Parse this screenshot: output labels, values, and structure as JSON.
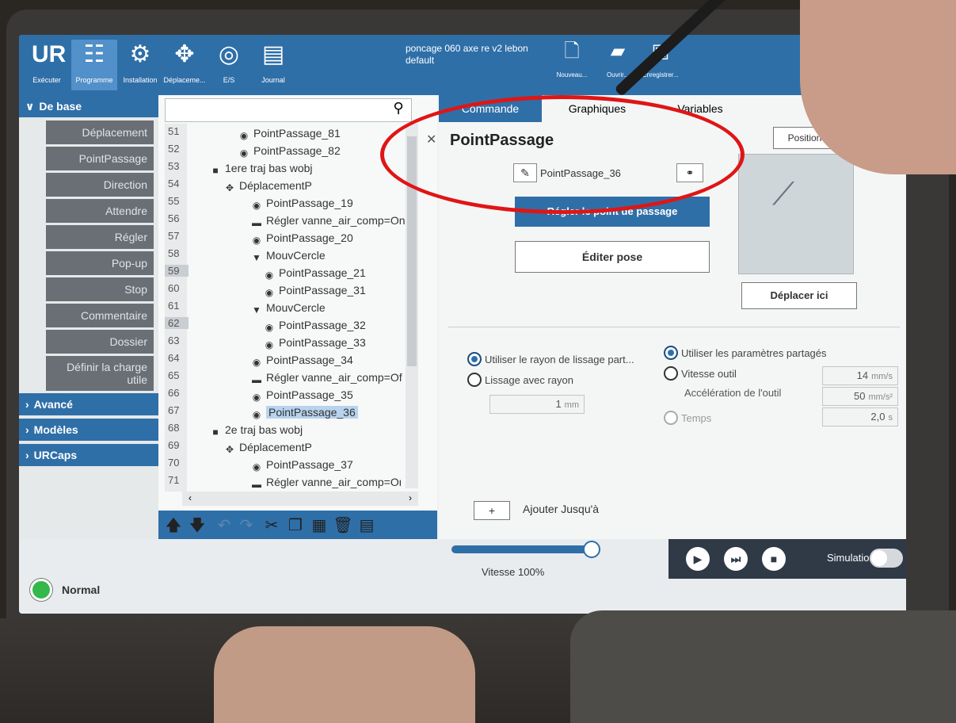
{
  "toolbar": {
    "tools": [
      {
        "label": "Exécuter",
        "icon": "ur-logo-icon"
      },
      {
        "label": "Programme",
        "icon": "program-icon"
      },
      {
        "label": "Installation",
        "icon": "installation-icon"
      },
      {
        "label": "Déplaceme...",
        "icon": "move-icon"
      },
      {
        "label": "E/S",
        "icon": "io-icon"
      },
      {
        "label": "Journal",
        "icon": "log-icon"
      }
    ],
    "program_name": "poncage 060 axe re v2 lebon",
    "installation_name": "default",
    "file_tools": [
      {
        "label": "Nouveau...",
        "icon": "new-file-icon"
      },
      {
        "label": "Ouvrir...",
        "icon": "open-folder-icon"
      },
      {
        "label": "Enregistrer...",
        "icon": "save-icon"
      }
    ]
  },
  "categories": {
    "basic_header": "De base",
    "basic_items": [
      "Déplacement",
      "PointPassage",
      "Direction",
      "Attendre",
      "Régler",
      "Pop-up",
      "Stop",
      "Commentaire",
      "Dossier",
      "Définir la charge utile"
    ],
    "advanced": "Avancé",
    "templates": "Modèles",
    "urcaps": "URCaps"
  },
  "tree": {
    "line_numbers": [
      "51",
      "52",
      "53",
      "54",
      "55",
      "56",
      "57",
      "58",
      "59",
      "60",
      "61",
      "62",
      "63",
      "64",
      "65",
      "66",
      "67",
      "68",
      "69",
      "70",
      "71"
    ],
    "nodes": [
      "PointPassage_81",
      "PointPassage_82",
      "1ere traj bas wobj",
      "DéplacementP",
      "PointPassage_19",
      "Régler vanne_air_comp=On",
      "PointPassage_20",
      "MouvCercle",
      "PointPassage_21",
      "PointPassage_31",
      "MouvCercle",
      "PointPassage_32",
      "PointPassage_33",
      "PointPassage_34",
      "Régler vanne_air_comp=Of",
      "PointPassage_35",
      "PointPassage_36",
      "2e traj bas wobj",
      "DéplacementP",
      "PointPassage_37",
      "Régler vanne_air_comp=On"
    ],
    "selected": "PointPassage_36"
  },
  "panel": {
    "tabs": [
      "Commande",
      "Graphiques",
      "Variables"
    ],
    "title": "PointPassage",
    "waypoint_name": "PointPassage_36",
    "fixed_position": "Position fixe",
    "set_waypoint": "Régler le point de passage",
    "edit_pose": "Éditer pose",
    "move_here": "Déplacer ici",
    "blend_shared": "Utiliser le rayon de lissage part...",
    "blend_radius": "Lissage avec rayon",
    "blend_value": "1",
    "blend_unit": "mm",
    "params_shared": "Utiliser les paramètres partagés",
    "tool_speed": "Vitesse outil",
    "tool_speed_value": "14",
    "tool_speed_unit": "mm/s",
    "tool_accel": "Accélération de l'outil",
    "tool_accel_value": "50",
    "tool_accel_unit": "mm/s²",
    "time": "Temps",
    "time_value": "2,0",
    "time_unit": "s",
    "add_until": "Ajouter Jusqu'à"
  },
  "bottom": {
    "speed_label": "Vitesse 100%",
    "speed_fraction": 1.0,
    "simulation": "Simulation",
    "status": "Normal"
  },
  "colors": {
    "accent": "#2f6fa8",
    "status_ok": "#34b84a",
    "annotation": "#e01515"
  }
}
